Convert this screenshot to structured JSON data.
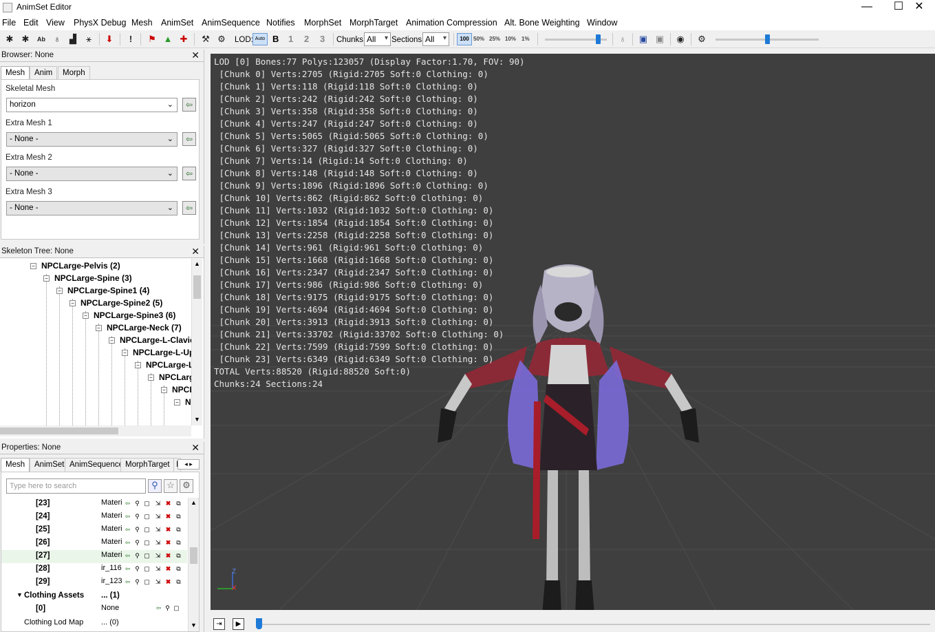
{
  "window": {
    "title": "AnimSet Editor",
    "minimize": "—",
    "maximize": "☐",
    "close": "✕"
  },
  "menu": [
    "File",
    "Edit",
    "View",
    "PhysX Debug",
    "Mesh",
    "AnimSet",
    "AnimSequence",
    "Notifies",
    "MorphSet",
    "MorphTarget",
    "Animation Compression",
    "Alt. Bone Weighting",
    "Window"
  ],
  "toolbar": {
    "lod_label": "LOD:",
    "lod_auto": "Auto",
    "lod_b": "B",
    "lod_1": "1",
    "lod_2": "2",
    "lod_3": "3",
    "chunks_label": "Chunks:",
    "chunks_value": "All",
    "sections_label": "Sections:",
    "sections_value": "All",
    "zoom_100": "100",
    "zoom_50": "50%",
    "zoom_25": "25%",
    "zoom_10": "10%",
    "zoom_1": "1%",
    "slider1_level": 0.85,
    "slider2_level": 0.5
  },
  "browser": {
    "header": "Browser: None",
    "tabs": [
      "Mesh",
      "Anim",
      "Morph"
    ],
    "skeletal_label": "Skeletal Mesh",
    "skeletal_value": "horizon",
    "extra1_label": "Extra Mesh 1",
    "extra1_value": "- None -",
    "extra2_label": "Extra Mesh 2",
    "extra2_value": "- None -",
    "extra3_label": "Extra Mesh 3",
    "extra3_value": "- None -"
  },
  "skeleton": {
    "header": "Skeleton Tree: None",
    "nodes": [
      "NPCLarge-Pelvis (2)",
      "NPCLarge-Spine (3)",
      "NPCLarge-Spine1 (4)",
      "NPCLarge-Spine2 (5)",
      "NPCLarge-Spine3 (6)",
      "NPCLarge-Neck (7)",
      "NPCLarge-L-Clavic",
      "NPCLarge-L-Up",
      "NPCLarge-L",
      "NPCLarg",
      "NPCL",
      "N"
    ]
  },
  "properties": {
    "header": "Properties: None",
    "tabs": [
      "Mesh",
      "AnimSet",
      "AnimSequence",
      "MorphTarget",
      "I"
    ],
    "search_placeholder": "Type here to search",
    "rows": [
      {
        "key": "[23]",
        "value": "Materi"
      },
      {
        "key": "[24]",
        "value": "Materi"
      },
      {
        "key": "[25]",
        "value": "Materi"
      },
      {
        "key": "[26]",
        "value": "Materi"
      },
      {
        "key": "[27]",
        "value": "Materi"
      },
      {
        "key": "[28]",
        "value": "ir_116"
      },
      {
        "key": "[29]",
        "value": "ir_123"
      }
    ],
    "clothing_label": "Clothing Assets",
    "clothing_value": "... (1)",
    "clothing0_key": "[0]",
    "clothing0_value": "None",
    "clothing_lod_label": "Clothing Lod Map",
    "clothing_lod_value": "... (0)"
  },
  "viewport": {
    "lod_line": "LOD [0] Bones:77 Polys:123057 (Display Factor:1.70, FOV: 90)",
    "chunks": [
      " [Chunk 0] Verts:2705 (Rigid:2705 Soft:0 Clothing: 0)",
      " [Chunk 1] Verts:118 (Rigid:118 Soft:0 Clothing: 0)",
      " [Chunk 2] Verts:242 (Rigid:242 Soft:0 Clothing: 0)",
      " [Chunk 3] Verts:358 (Rigid:358 Soft:0 Clothing: 0)",
      " [Chunk 4] Verts:247 (Rigid:247 Soft:0 Clothing: 0)",
      " [Chunk 5] Verts:5065 (Rigid:5065 Soft:0 Clothing: 0)",
      " [Chunk 6] Verts:327 (Rigid:327 Soft:0 Clothing: 0)",
      " [Chunk 7] Verts:14 (Rigid:14 Soft:0 Clothing: 0)",
      " [Chunk 8] Verts:148 (Rigid:148 Soft:0 Clothing: 0)",
      " [Chunk 9] Verts:1896 (Rigid:1896 Soft:0 Clothing: 0)",
      " [Chunk 10] Verts:862 (Rigid:862 Soft:0 Clothing: 0)",
      " [Chunk 11] Verts:1032 (Rigid:1032 Soft:0 Clothing: 0)",
      " [Chunk 12] Verts:1854 (Rigid:1854 Soft:0 Clothing: 0)",
      " [Chunk 13] Verts:2258 (Rigid:2258 Soft:0 Clothing: 0)",
      " [Chunk 14] Verts:961 (Rigid:961 Soft:0 Clothing: 0)",
      " [Chunk 15] Verts:1668 (Rigid:1668 Soft:0 Clothing: 0)",
      " [Chunk 16] Verts:2347 (Rigid:2347 Soft:0 Clothing: 0)",
      " [Chunk 17] Verts:986 (Rigid:986 Soft:0 Clothing: 0)",
      " [Chunk 18] Verts:9175 (Rigid:9175 Soft:0 Clothing: 0)",
      " [Chunk 19] Verts:4694 (Rigid:4694 Soft:0 Clothing: 0)",
      " [Chunk 20] Verts:3913 (Rigid:3913 Soft:0 Clothing: 0)",
      " [Chunk 21] Verts:33702 (Rigid:33702 Soft:0 Clothing: 0)",
      " [Chunk 22] Verts:7599 (Rigid:7599 Soft:0 Clothing: 0)",
      " [Chunk 23] Verts:6349 (Rigid:6349 Soft:0 Clothing: 0)"
    ],
    "total_line": "TOTAL Verts:88520 (Rigid:88520 Soft:0)",
    "chunks_line": "Chunks:24 Sections:24",
    "axis_z": "Z",
    "axis_x": "X"
  },
  "colors": {
    "viewport_bg": "#3f3f3f",
    "hud_text": "#e6e6e6",
    "accent": "#1e7ad6"
  }
}
